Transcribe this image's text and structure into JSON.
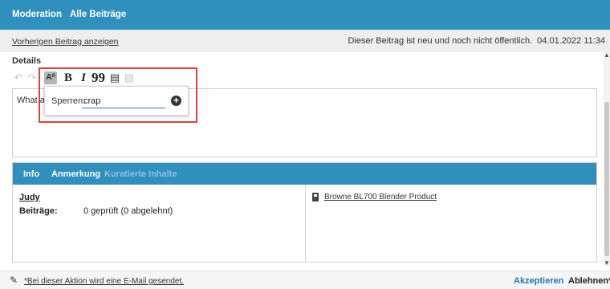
{
  "top_tabs": {
    "moderation": "Moderation",
    "all_posts": "Alle Beiträge"
  },
  "subbar": {
    "prev_link": "Vorherigen Beitrag anzeigen",
    "status": "Dieser Beitrag ist neu und noch nicht öffentlich.",
    "timestamp": "04.01.2022 11:34"
  },
  "details": {
    "label": "Details"
  },
  "toolbar": {
    "undo_icon": "↶",
    "redo_icon": "↷",
    "chip_icon": "A⁰",
    "bold": "B",
    "italic": "I",
    "quote": "99",
    "embed_icon": "▤",
    "clear_icon": "▧"
  },
  "editor": {
    "content": "What ab"
  },
  "block_popover": {
    "label": "Sperren:",
    "value": "crap",
    "add_icon": "+"
  },
  "info_panel": {
    "tabs": {
      "info": "Info",
      "note": "Anmerkung",
      "curated": "Kuratierte Inhalte"
    },
    "user": "Judy",
    "posts_label": "Beiträge:",
    "posts_value": "0 geprüft (0 abgelehnt)",
    "product": "Browne BL700 Blender Product"
  },
  "scrollbar": {
    "up_icon": "▲",
    "down_icon": "▼"
  },
  "footer": {
    "pen_icon": "✎",
    "email_note": "*Bei dieser Aktion wird eine E-Mail gesendet.",
    "accept": "Akzeptieren",
    "reject": "Ablehnen*"
  },
  "colors": {
    "brand": "#2f8fbd",
    "accept": "#1f79b0",
    "highlight": "#e0403a"
  }
}
